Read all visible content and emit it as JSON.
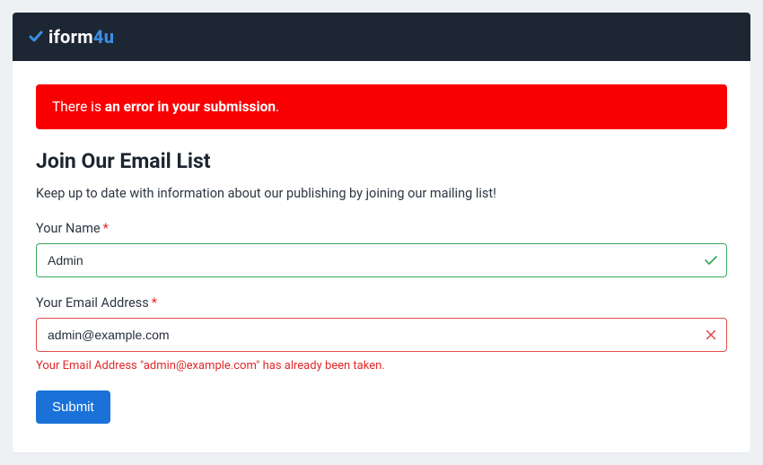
{
  "brand": {
    "name_part1": "iform",
    "name_part2": "4u"
  },
  "alert": {
    "prefix": "There is ",
    "bold": "an error in your submission",
    "suffix": "."
  },
  "page": {
    "title": "Join Our Email List",
    "subtitle": "Keep up to date with information about our publishing by joining our mailing list!"
  },
  "form": {
    "name": {
      "label": "Your Name",
      "required_mark": "*",
      "value": "Admin"
    },
    "email": {
      "label": "Your Email Address",
      "required_mark": "*",
      "value": "admin@example.com",
      "error": "Your Email Address \"admin@example.com\" has already been taken."
    },
    "submit_label": "Submit"
  }
}
